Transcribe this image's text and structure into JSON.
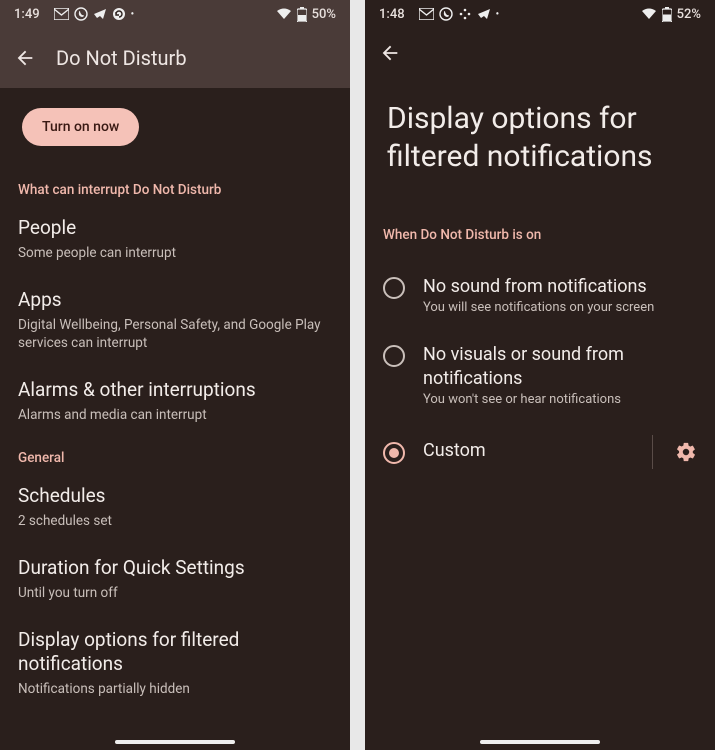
{
  "left": {
    "status": {
      "time": "1:49",
      "battery": "50%"
    },
    "header_title": "Do Not Disturb",
    "turn_on_label": "Turn on now",
    "section_interrupt": "What can interrupt Do Not Disturb",
    "people": {
      "title": "People",
      "sub": "Some people can interrupt"
    },
    "apps": {
      "title": "Apps",
      "sub": "Digital Wellbeing, Personal Safety, and Google Play services can interrupt"
    },
    "alarms": {
      "title": "Alarms & other interruptions",
      "sub": "Alarms and media can interrupt"
    },
    "section_general": "General",
    "schedules": {
      "title": "Schedules",
      "sub": "2 schedules set"
    },
    "duration": {
      "title": "Duration for Quick Settings",
      "sub": "Until you turn off"
    },
    "display_opts": {
      "title": "Display options for filtered notifications",
      "sub": "Notifications partially hidden"
    }
  },
  "right": {
    "status": {
      "time": "1:48",
      "battery": "52%"
    },
    "page_title": "Display options for filtered notifications",
    "section_when": "When Do Not Disturb is on",
    "opt1": {
      "title": "No sound from notifications",
      "sub": "You will see notifications on your screen"
    },
    "opt2": {
      "title": "No visuals or sound from notifications",
      "sub": "You won't see or hear notifications"
    },
    "opt3": {
      "title": "Custom"
    }
  }
}
